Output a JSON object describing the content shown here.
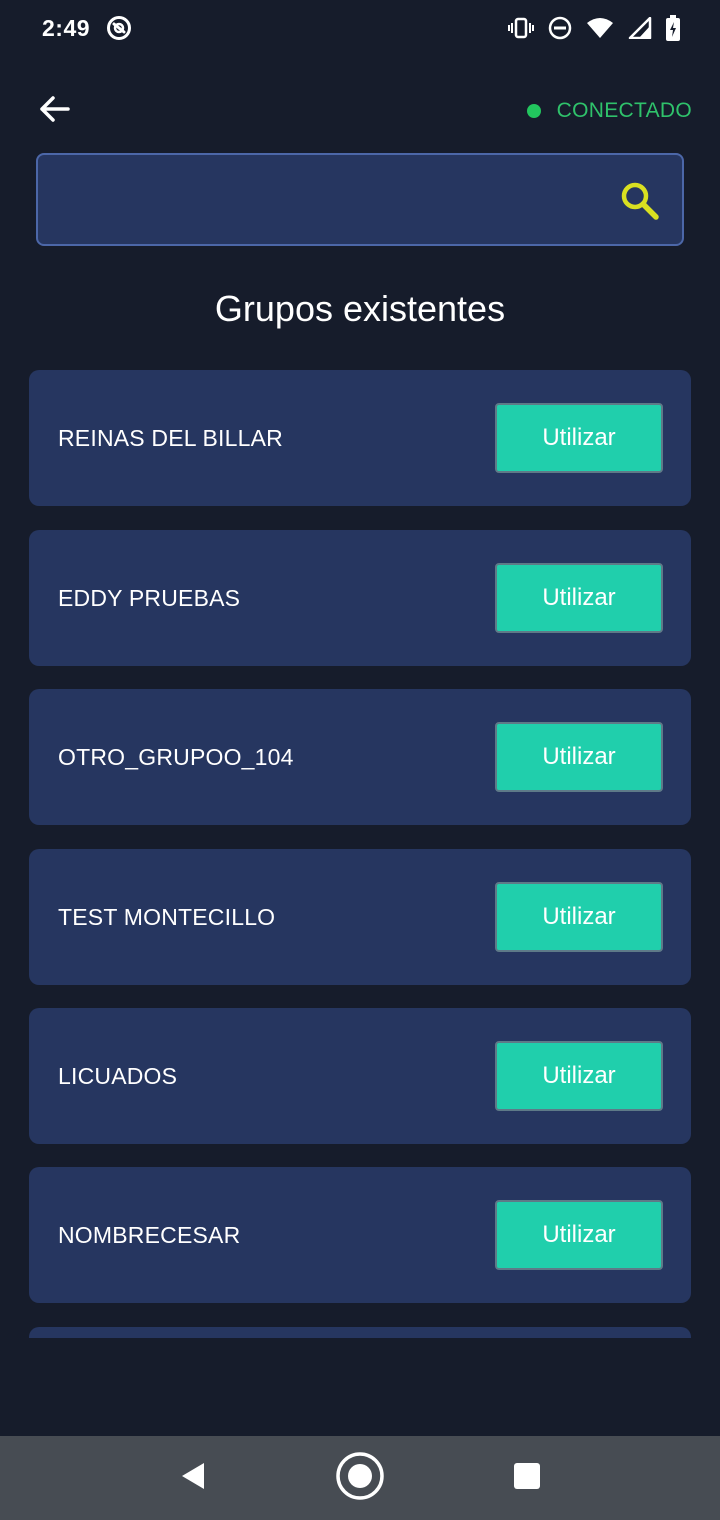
{
  "status_bar": {
    "time": "2:49"
  },
  "header": {
    "back_icon": "arrow-left-icon",
    "connection_status": "CONECTADO",
    "connection_color": "#22c55e"
  },
  "search": {
    "value": "",
    "placeholder": "",
    "icon": "search-icon",
    "icon_color": "#d9e021"
  },
  "main": {
    "title": "Grupos existentes",
    "groups": [
      {
        "name": "REINAS DEL BILLAR",
        "button_label": "Utilizar"
      },
      {
        "name": "EDDY PRUEBAS",
        "button_label": "Utilizar"
      },
      {
        "name": "OTRO_GRUPOO_104",
        "button_label": "Utilizar"
      },
      {
        "name": "TEST MONTECILLO",
        "button_label": "Utilizar"
      },
      {
        "name": "LICUADOS",
        "button_label": "Utilizar"
      },
      {
        "name": "NOMBRECESAR",
        "button_label": "Utilizar"
      }
    ]
  },
  "colors": {
    "background": "#161c2b",
    "card": "#263660",
    "accent_button": "#20cfac"
  },
  "nav_bar": {
    "back": "triangle-back-icon",
    "home": "circle-home-icon",
    "recents": "square-recents-icon"
  }
}
